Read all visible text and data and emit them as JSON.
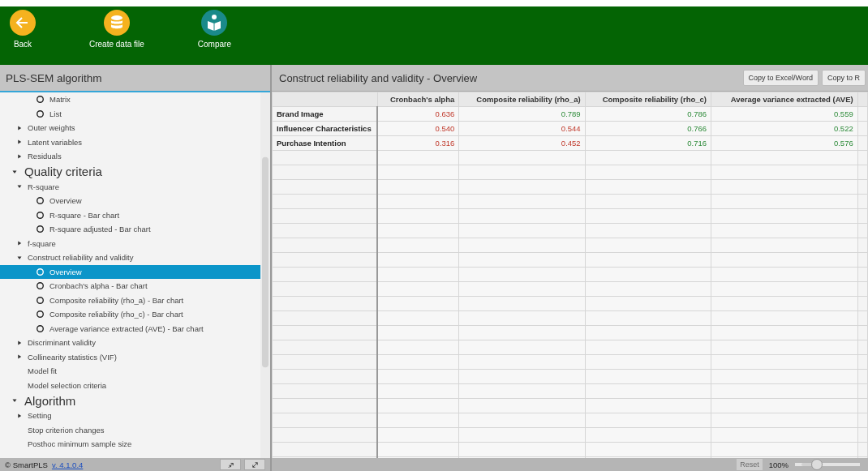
{
  "toolbar": {
    "buttons": [
      {
        "label": "Back",
        "kind": "back"
      },
      {
        "label": "Create data file",
        "kind": "database"
      },
      {
        "label": "Compare",
        "kind": "compare"
      }
    ]
  },
  "left_panel": {
    "title": "PLS-SEM algorithm",
    "tree": [
      {
        "children": [
          {
            "children": [
              {
                "kind": "radio",
                "label": "Matrix",
                "selected": false
              },
              {
                "kind": "radio",
                "label": "List",
                "selected": false
              }
            ]
          },
          {
            "kind": "group",
            "label": "Outer weights",
            "expanded": false
          },
          {
            "kind": "group",
            "label": "Latent variables",
            "expanded": false
          },
          {
            "kind": "group",
            "label": "Residuals",
            "expanded": false
          }
        ]
      },
      {
        "kind": "section",
        "label": "Quality criteria",
        "expanded": true,
        "children": [
          {
            "kind": "group",
            "label": "R-square",
            "expanded": true,
            "children": [
              {
                "kind": "radio",
                "label": "Overview",
                "selected": false
              },
              {
                "kind": "radio",
                "label": "R-square - Bar chart",
                "selected": false
              },
              {
                "kind": "radio",
                "label": "R-square adjusted - Bar chart",
                "selected": false
              }
            ]
          },
          {
            "kind": "group",
            "label": "f-square",
            "expanded": false
          },
          {
            "kind": "group",
            "label": "Construct reliability and validity",
            "expanded": true,
            "children": [
              {
                "kind": "radio",
                "label": "Overview",
                "selected": true
              },
              {
                "kind": "radio",
                "label": "Cronbach's alpha - Bar chart",
                "selected": false
              },
              {
                "kind": "radio",
                "label": "Composite reliability (rho_a) - Bar chart",
                "selected": false
              },
              {
                "kind": "radio",
                "label": "Composite reliability (rho_c) - Bar chart",
                "selected": false
              },
              {
                "kind": "radio",
                "label": "Average variance extracted (AVE) - Bar chart",
                "selected": false
              }
            ]
          },
          {
            "kind": "group",
            "label": "Discriminant validity",
            "expanded": false
          },
          {
            "kind": "group",
            "label": "Collinearity statistics (VIF)",
            "expanded": false
          },
          {
            "kind": "leaf",
            "label": "Model fit"
          },
          {
            "kind": "leaf",
            "label": "Model selection criteria"
          }
        ]
      },
      {
        "kind": "section",
        "label": "Algorithm",
        "expanded": true,
        "children": [
          {
            "kind": "group",
            "label": "Setting",
            "expanded": false
          },
          {
            "kind": "leaf",
            "label": "Stop criterion changes"
          },
          {
            "kind": "leaf",
            "label": "Posthoc minimum sample size"
          }
        ]
      }
    ],
    "footer": {
      "brand": "© SmartPLS",
      "version": "v. 4.1.0.4"
    }
  },
  "right_panel": {
    "title": "Construct reliability and validity - Overview",
    "buttons": [
      "Copy to Excel/Word",
      "Copy to R"
    ],
    "table": {
      "columns": [
        "Cronbach's alpha",
        "Composite reliability (rho_a)",
        "Composite reliability (rho_c)",
        "Average variance extracted (AVE)"
      ],
      "rows": [
        {
          "name": "Brand Image",
          "cells": [
            {
              "value": "0.636",
              "pass": false
            },
            {
              "value": "0.789",
              "pass": true
            },
            {
              "value": "0.786",
              "pass": true
            },
            {
              "value": "0.559",
              "pass": true
            }
          ]
        },
        {
          "name": "Influencer Characteristics",
          "cells": [
            {
              "value": "0.540",
              "pass": false
            },
            {
              "value": "0.544",
              "pass": false
            },
            {
              "value": "0.766",
              "pass": true
            },
            {
              "value": "0.522",
              "pass": true
            }
          ]
        },
        {
          "name": "Purchase Intention",
          "cells": [
            {
              "value": "0.316",
              "pass": false
            },
            {
              "value": "0.452",
              "pass": false
            },
            {
              "value": "0.716",
              "pass": true
            },
            {
              "value": "0.576",
              "pass": true
            }
          ]
        }
      ]
    },
    "zoom": {
      "reset": "Reset",
      "reset_disabled": true,
      "percent": "100%",
      "level": 0.25
    }
  }
}
